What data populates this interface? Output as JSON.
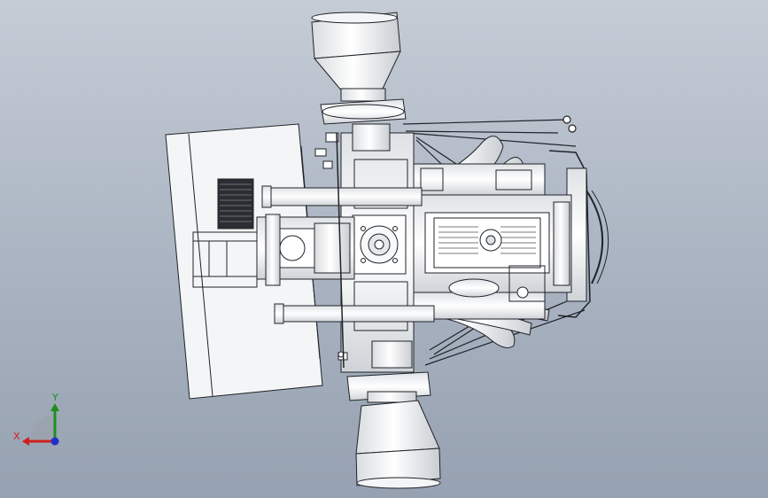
{
  "viewport": {
    "background_top": "#c5ccd6",
    "background_bottom": "#96a1b1",
    "model_fill": "#f4f5f6",
    "model_stroke": "#1f2328"
  },
  "triad": {
    "x_label": "X",
    "y_label": "Y",
    "x_color": "#d01f1f",
    "y_color": "#1c8f1c",
    "z_color": "#2230c8"
  }
}
